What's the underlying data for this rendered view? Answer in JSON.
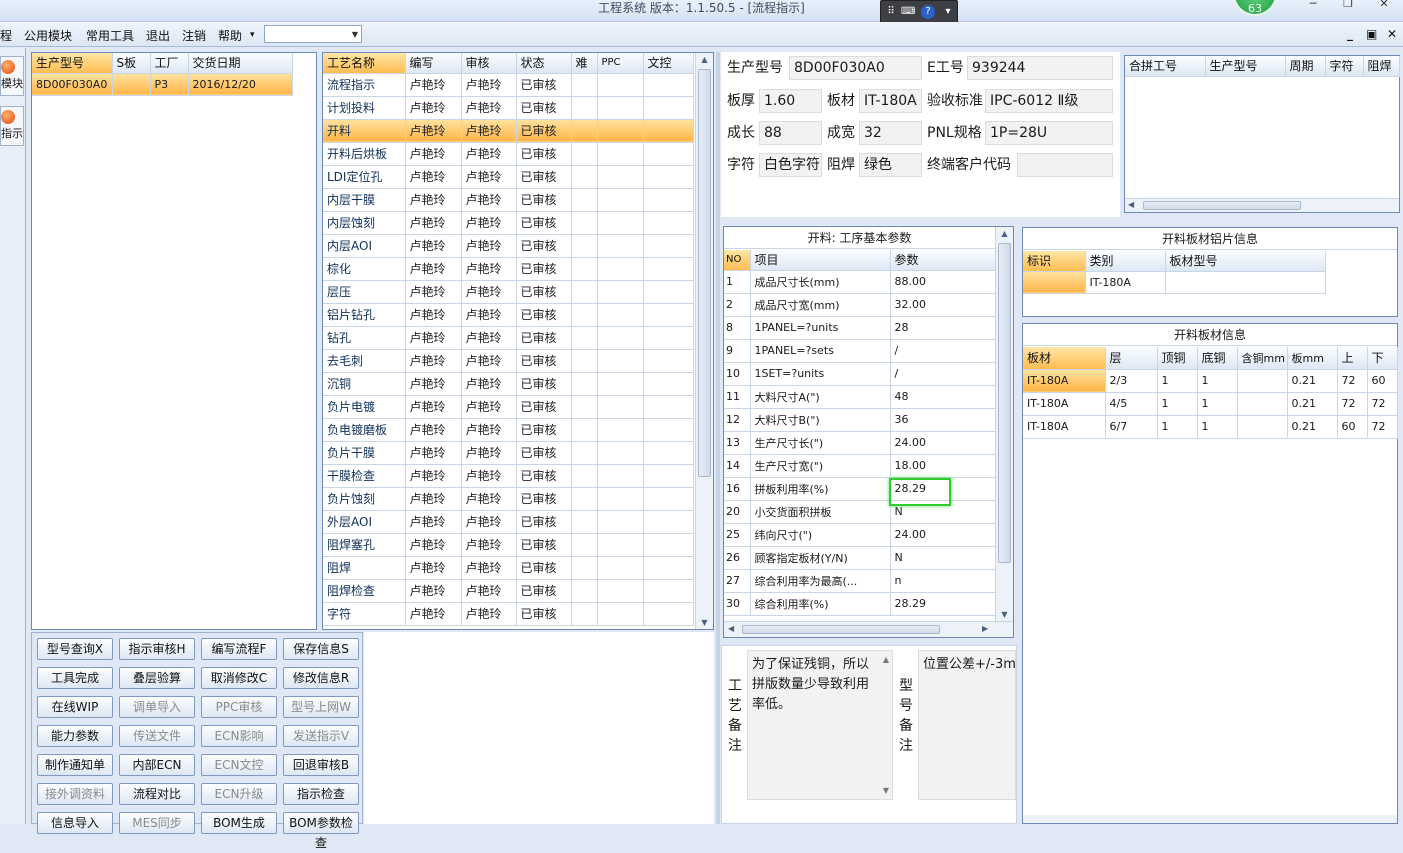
{
  "window": {
    "title": "工程系统   版本：1.1.50.5 - [流程指示]",
    "badge": "63"
  },
  "menu": {
    "items": [
      "程",
      "公用模块",
      "常用工具",
      "退出",
      "注销",
      "帮助"
    ],
    "help_arrow": "▾",
    "combo_value": ""
  },
  "left_strip": {
    "items": [
      "模块",
      "指示"
    ]
  },
  "product_list": {
    "columns": [
      "生产型号",
      "S板",
      "工厂",
      "交货日期"
    ],
    "rows": [
      [
        "8D00F030A0",
        "",
        "P3",
        "2016/12/20"
      ]
    ]
  },
  "process_list": {
    "columns": [
      "工艺名称",
      "编写",
      "审核",
      "状态",
      "难",
      "PPC",
      "文控"
    ],
    "selected_index": 2,
    "rows": [
      [
        "流程指示",
        "卢艳玲",
        "卢艳玲",
        "已审核"
      ],
      [
        "计划投料",
        "卢艳玲",
        "卢艳玲",
        "已审核"
      ],
      [
        "开料",
        "卢艳玲",
        "卢艳玲",
        "已审核"
      ],
      [
        "开料后烘板",
        "卢艳玲",
        "卢艳玲",
        "已审核"
      ],
      [
        "LDI定位孔",
        "卢艳玲",
        "卢艳玲",
        "已审核"
      ],
      [
        "内层干膜",
        "卢艳玲",
        "卢艳玲",
        "已审核"
      ],
      [
        "内层蚀刻",
        "卢艳玲",
        "卢艳玲",
        "已审核"
      ],
      [
        "内层AOI",
        "卢艳玲",
        "卢艳玲",
        "已审核"
      ],
      [
        "棕化",
        "卢艳玲",
        "卢艳玲",
        "已审核"
      ],
      [
        "层压",
        "卢艳玲",
        "卢艳玲",
        "已审核"
      ],
      [
        "铝片钻孔",
        "卢艳玲",
        "卢艳玲",
        "已审核"
      ],
      [
        "钻孔",
        "卢艳玲",
        "卢艳玲",
        "已审核"
      ],
      [
        "去毛刺",
        "卢艳玲",
        "卢艳玲",
        "已审核"
      ],
      [
        "沉铜",
        "卢艳玲",
        "卢艳玲",
        "已审核"
      ],
      [
        "负片电镀",
        "卢艳玲",
        "卢艳玲",
        "已审核"
      ],
      [
        "负电镀磨板",
        "卢艳玲",
        "卢艳玲",
        "已审核"
      ],
      [
        "负片干膜",
        "卢艳玲",
        "卢艳玲",
        "已审核"
      ],
      [
        "干膜检查",
        "卢艳玲",
        "卢艳玲",
        "已审核"
      ],
      [
        "负片蚀刻",
        "卢艳玲",
        "卢艳玲",
        "已审核"
      ],
      [
        "外层AOI",
        "卢艳玲",
        "卢艳玲",
        "已审核"
      ],
      [
        "阻焊塞孔",
        "卢艳玲",
        "卢艳玲",
        "已审核"
      ],
      [
        "阻焊",
        "卢艳玲",
        "卢艳玲",
        "已审核"
      ],
      [
        "阻焊检查",
        "卢艳玲",
        "卢艳玲",
        "已审核"
      ],
      [
        "字符",
        "卢艳玲",
        "卢艳玲",
        "已审核"
      ]
    ]
  },
  "buttons": [
    {
      "label": "型号查询X",
      "enabled": true
    },
    {
      "label": "指示审核H",
      "enabled": true
    },
    {
      "label": "编写流程F",
      "enabled": true
    },
    {
      "label": "保存信息S",
      "enabled": true
    },
    {
      "label": "工具完成",
      "enabled": true
    },
    {
      "label": "叠层验算",
      "enabled": true
    },
    {
      "label": "取消修改C",
      "enabled": true
    },
    {
      "label": "修改信息R",
      "enabled": true
    },
    {
      "label": "在线WIP",
      "enabled": true
    },
    {
      "label": "调单导入",
      "enabled": false
    },
    {
      "label": "PPC审核",
      "enabled": false
    },
    {
      "label": "型号上网W",
      "enabled": false
    },
    {
      "label": "能力参数",
      "enabled": true
    },
    {
      "label": "传送文件",
      "enabled": false
    },
    {
      "label": "ECN影响",
      "enabled": false
    },
    {
      "label": "发送指示V",
      "enabled": false
    },
    {
      "label": "制作通知单",
      "enabled": true
    },
    {
      "label": "内部ECN",
      "enabled": true
    },
    {
      "label": "ECN文控",
      "enabled": false
    },
    {
      "label": "回退审核B",
      "enabled": true
    },
    {
      "label": "接外调资料",
      "enabled": false
    },
    {
      "label": "流程对比",
      "enabled": true
    },
    {
      "label": "ECN升级",
      "enabled": false
    },
    {
      "label": "指示检查",
      "enabled": true
    },
    {
      "label": "信息导入",
      "enabled": true
    },
    {
      "label": "MES同步",
      "enabled": false
    },
    {
      "label": "BOM生成",
      "enabled": true
    },
    {
      "label": "BOM参数检查",
      "enabled": true
    }
  ],
  "info": {
    "model_label": "生产型号",
    "model": "8D00F030A0",
    "eno_label": "E工号",
    "eno": "939244",
    "thick_label": "板厚",
    "thick": "1.60",
    "material_label": "板材",
    "material": "IT-180A",
    "std_label": "验收标准",
    "std": "IPC-6012 Ⅱ级",
    "len_label": "成长",
    "len": "88",
    "wid_label": "成宽",
    "wid": "32",
    "pnl_label": "PNL规格",
    "pnl": "1P=28U",
    "char_label": "字符",
    "char": "白色字符",
    "mask_label": "阻焊",
    "mask": "绿色",
    "cust_label": "终端客户代码",
    "cust": ""
  },
  "merge_table": {
    "columns": [
      "合拼工号",
      "生产型号",
      "周期",
      "字符",
      "阻焊"
    ]
  },
  "params": {
    "title": "开料: 工序基本参数",
    "columns": [
      "NO",
      "项目",
      "参数"
    ],
    "rows": [
      [
        "1",
        "成品尺寸长(mm)",
        "88.00"
      ],
      [
        "2",
        "成品尺寸宽(mm)",
        "32.00"
      ],
      [
        "8",
        "1PANEL=?units",
        "28"
      ],
      [
        "9",
        "1PANEL=?sets",
        "/"
      ],
      [
        "10",
        "1SET=?units",
        "/"
      ],
      [
        "11",
        "大料尺寸A(\")",
        "48"
      ],
      [
        "12",
        "大料尺寸B(\")",
        "36"
      ],
      [
        "13",
        "生产尺寸长(\")",
        "24.00"
      ],
      [
        "14",
        "生产尺寸宽(\")",
        "18.00"
      ],
      [
        "16",
        "拼板利用率(%)",
        "28.29"
      ],
      [
        "20",
        "小交货面积拼板",
        "N"
      ],
      [
        "25",
        "纬向尺寸(\")",
        "24.00"
      ],
      [
        "26",
        "顾客指定板材(Y/N)",
        "N"
      ],
      [
        "27",
        "综合利用率为最高(...",
        "n"
      ],
      [
        "30",
        "综合利用率(%)",
        "28.29"
      ]
    ]
  },
  "foil_info": {
    "title": "开料板材铝片信息",
    "columns": [
      "标识",
      "类别",
      "板材型号"
    ],
    "rows": [
      [
        "",
        "IT-180A",
        ""
      ]
    ]
  },
  "sheet_info": {
    "title": "开料板材信息",
    "columns": [
      "板材",
      "层",
      "顶铜",
      "底铜",
      "含铜mm",
      "板mm",
      "上",
      "下"
    ],
    "rows": [
      [
        "IT-180A",
        "2/3",
        "1",
        "1",
        "",
        "0.21",
        "72",
        "60"
      ],
      [
        "IT-180A",
        "4/5",
        "1",
        "1",
        "",
        "0.21",
        "72",
        "72"
      ],
      [
        "IT-180A",
        "6/7",
        "1",
        "1",
        "",
        "0.21",
        "60",
        "72"
      ]
    ]
  },
  "remarks": {
    "process_label": "工艺备注",
    "process_text": "为了保证残铜，所以拼版数量少导致利用率低。",
    "model_label": "型号备注",
    "model_text": "位置公差+/-3m"
  }
}
